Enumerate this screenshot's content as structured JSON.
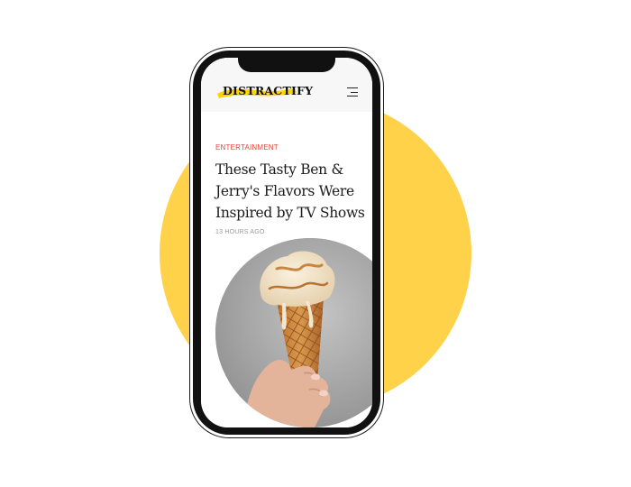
{
  "colors": {
    "background": "#ffffff",
    "accent_yellow": "#FFD24A",
    "category_red": "#E0443C",
    "phone_frame": "#111111"
  },
  "header": {
    "logo_text": "DISTRACTIFY",
    "menu_icon": "hamburger-menu-icon"
  },
  "article": {
    "category": "ENTERTAINMENT",
    "headline_lines": [
      "These Tasty Ben &",
      "Jerry's Flavors Were",
      "Inspired by TV Shows"
    ],
    "timestamp": "13 HOURS AGO",
    "hero_image": "ice-cream-cone-photo"
  }
}
